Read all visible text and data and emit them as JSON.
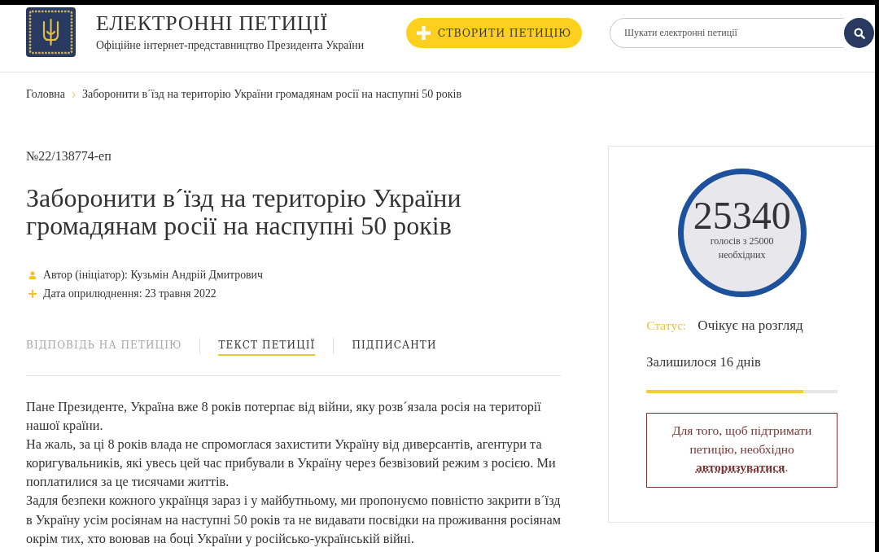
{
  "header": {
    "title": "ЕЛЕКТРОННІ ПЕТИЦІЇ",
    "subtitle": "Офіційне інтернет-представництво Президента України",
    "create_button": {
      "label": "СТВОРИТИ ПЕТИЦІЮ"
    },
    "search": {
      "placeholder": "Шукати електронні петиції"
    }
  },
  "breadcrumb": [
    {
      "label": "Головна"
    },
    {
      "label": "Заборонити в´їзд на територію України громадянам росії на наспупні 50 років"
    }
  ],
  "petition": {
    "number": "№22/138774-еп",
    "title": "Заборонити в´їзд на територію України громадянам росії на наспупні 50 років",
    "meta": [
      {
        "kind": "author",
        "text": "Автор (ініціатор): Кузьмін Андрій Дмитрович"
      },
      {
        "kind": "date",
        "text": "Дата оприлюднення: 23 травня 2022"
      }
    ],
    "tabs": [
      {
        "label": "ВІДПОВІДЬ НА ПЕТИЦІЮ",
        "selected": false,
        "disabled": true
      },
      {
        "label": "ТЕКСТ ПЕТИЦІЇ",
        "selected": true,
        "disabled": false
      },
      {
        "label": "ПІДПИСАНТИ",
        "selected": false,
        "disabled": false
      }
    ],
    "body": [
      "Пане Президенте, Україна вже 8 років потерпає від війни, яку розв´язала росія на території нашої країни.",
      "На жаль, за ці 8 років влада не спромоглася захистити Україну від диверсантів, агентури та коригувальників, які увесь цей час прибували в Україну через безвізовий режим з росією. Ми поплатилися за це тисячами життів.",
      "Задля безпеки кожного українця зараз і у майбутньому, ми пропонуємо повністю закрити в´їзд в Україну усім росіянам на наступні 50 років та не видавати посвідки на проживання росіянам окрім тих, хто воював на боці України у російсько-українській війні."
    ]
  },
  "sidebar": {
    "votes": "25340",
    "votes_caption": "голосів з 25000 необхідних",
    "status_label": "Статус:",
    "status_value": "Очікує на розгляд",
    "remaining": "Залишилося 16 днів",
    "progress": {
      "level": 0.82
    },
    "notice": {
      "text": "Для того, щоб підтримати петицію, необхідно",
      "link": "авторизуватися",
      "end": "."
    }
  }
}
